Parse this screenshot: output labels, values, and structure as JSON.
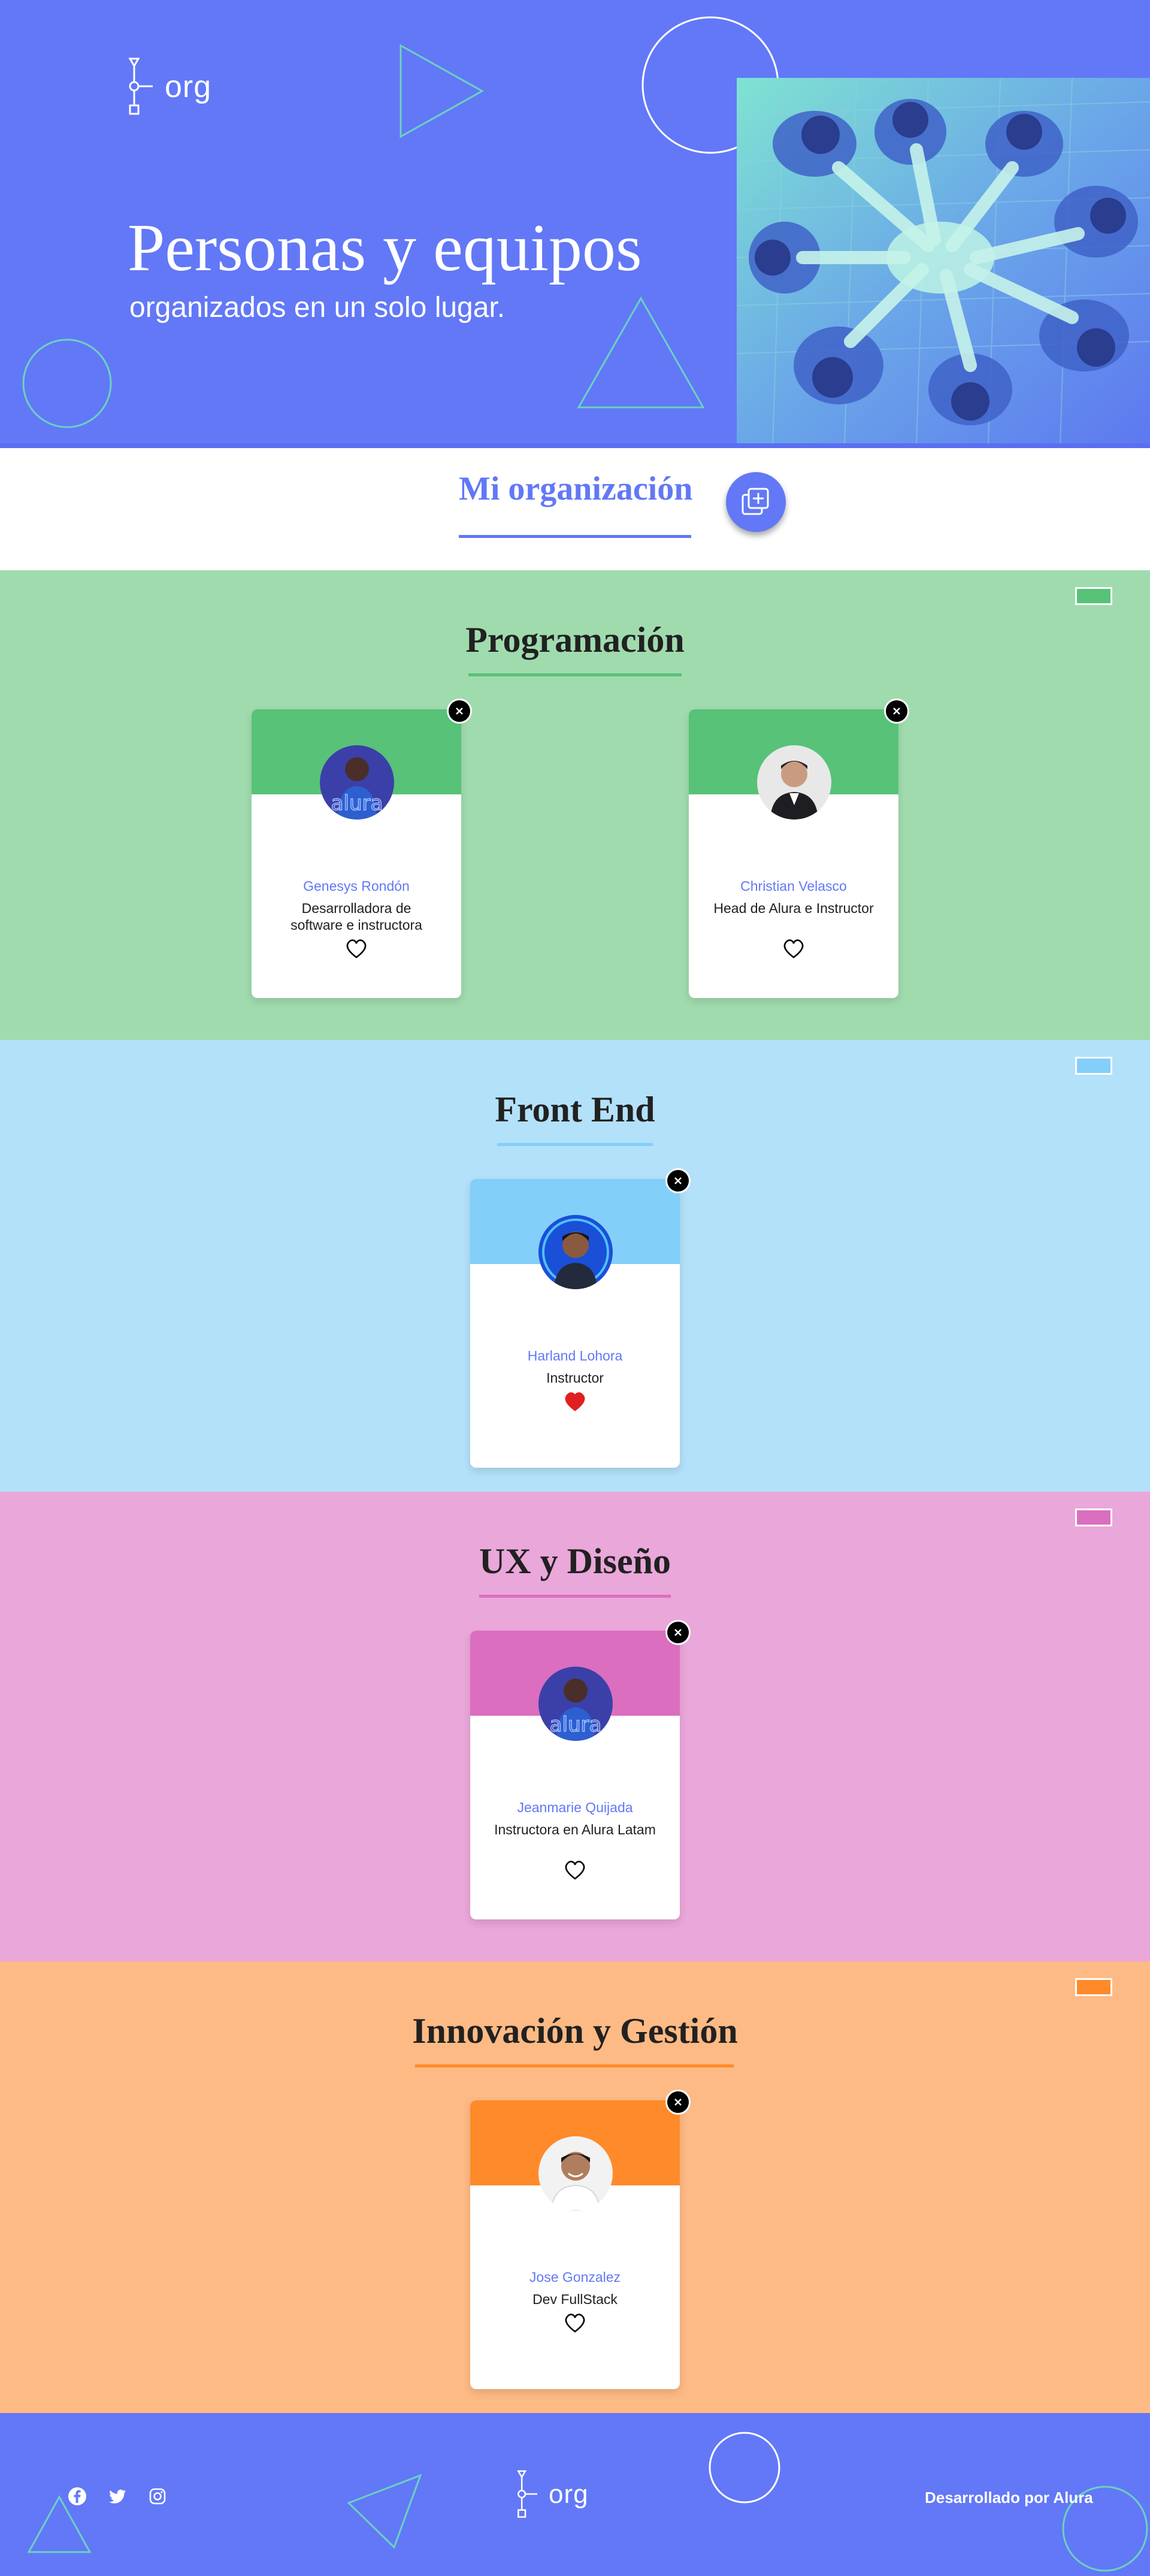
{
  "header": {
    "logo_text": "org",
    "title": "Personas y equipos",
    "subtitle": "organizados en un solo lugar.",
    "photo_icon": "team-hands-together-photo"
  },
  "org": {
    "title": "Mi organización",
    "add_button_icon": "add-stack-icon"
  },
  "colors": {
    "brand": "#6278f7",
    "white": "#ffffff",
    "like_filled": "#e02020"
  },
  "teams": [
    {
      "title": "Programación",
      "background": "#a0dbae",
      "primary": "#57c278",
      "members": [
        {
          "name": "Genesys Rondón",
          "role": "Desarrolladora de software e instructora",
          "liked": false,
          "avatar_icon": "person-photo"
        },
        {
          "name": "Christian Velasco",
          "role": "Head de Alura e Instructor",
          "liked": false,
          "avatar_icon": "person-photo"
        }
      ]
    },
    {
      "title": "Front End",
      "background": "#b3e1f9",
      "primary": "#82cffa",
      "members": [
        {
          "name": "Harland Lohora",
          "role": "Instructor",
          "liked": true,
          "avatar_icon": "person-photo"
        }
      ]
    },
    {
      "title": "UX y Diseño",
      "background": "#eaa7da",
      "primary": "#db6ebf",
      "members": [
        {
          "name": "Jeanmarie Quijada",
          "role": "Instructora en Alura Latam",
          "liked": false,
          "avatar_icon": "person-photo"
        }
      ]
    },
    {
      "title": "Innovación y Gestión",
      "background": "#feba84",
      "primary": "#ff8a29",
      "members": [
        {
          "name": "Jose Gonzalez",
          "role": "Dev FullStack",
          "liked": false,
          "avatar_icon": "person-photo"
        }
      ]
    }
  ],
  "footer": {
    "logo_text": "org",
    "credit": "Desarrollado por Alura",
    "social_icons": [
      "facebook-icon",
      "twitter-icon",
      "instagram-icon"
    ]
  }
}
